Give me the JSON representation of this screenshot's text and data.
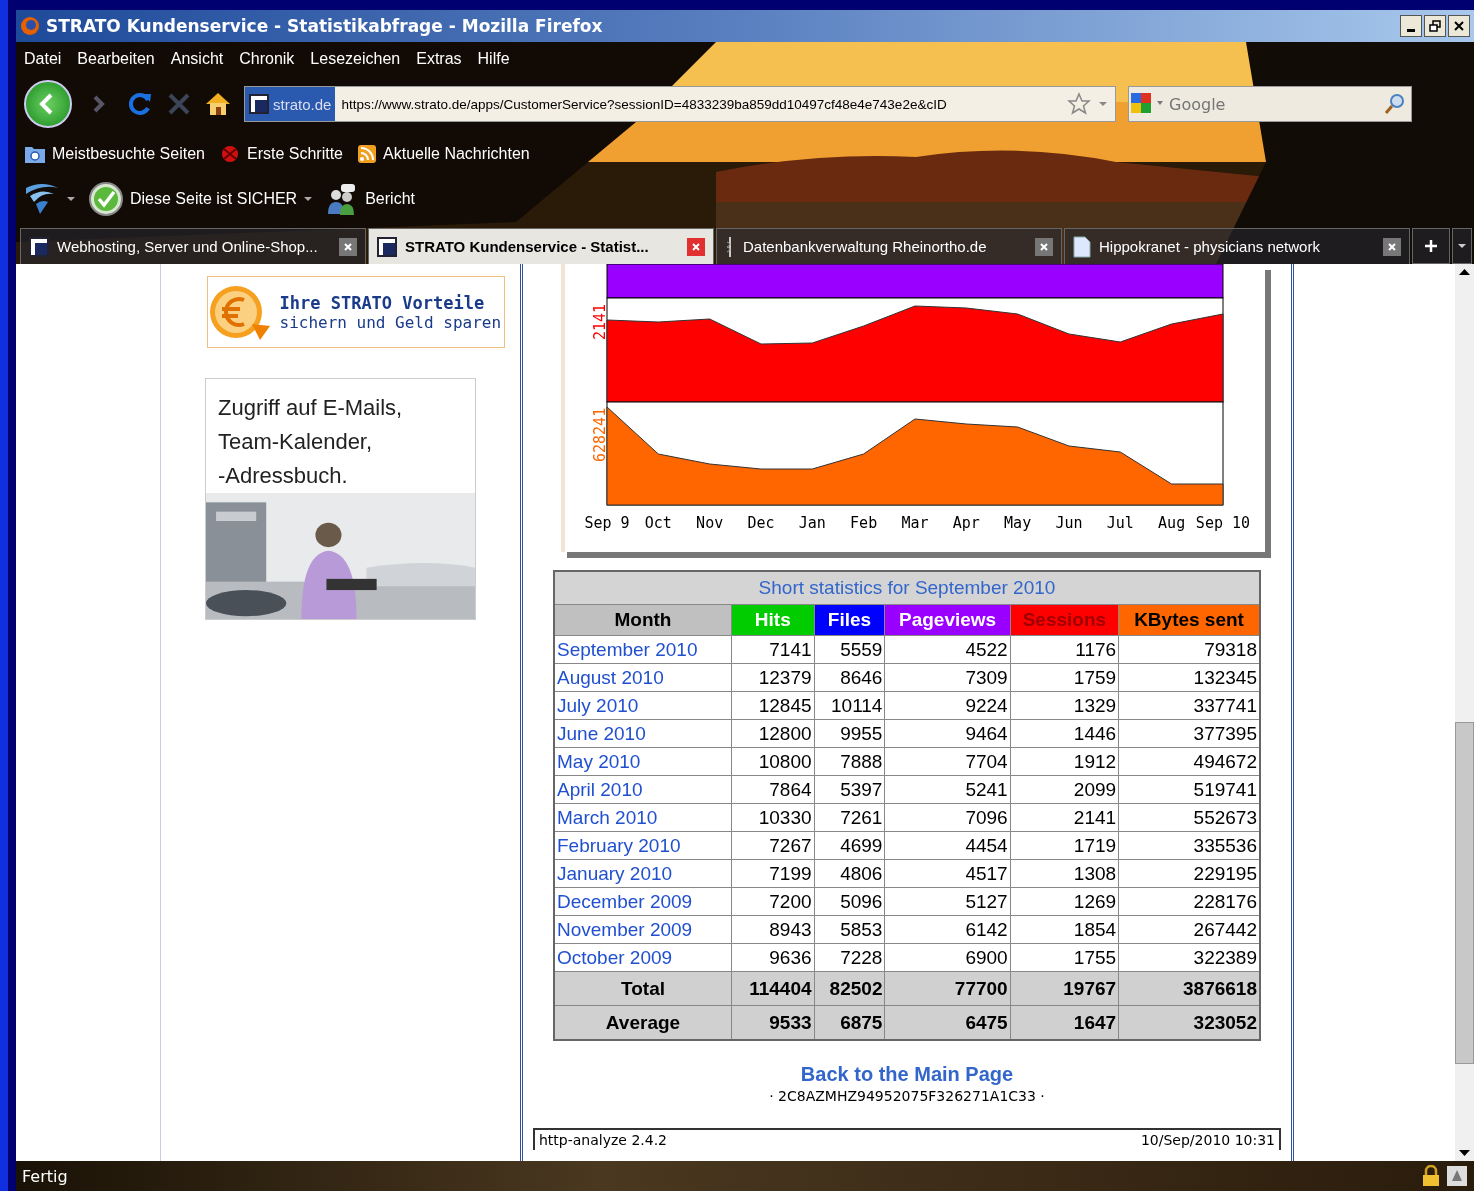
{
  "window": {
    "title": "STRATO Kundenservice - Statistikabfrage - Mozilla Firefox"
  },
  "menu": [
    "Datei",
    "Bearbeiten",
    "Ansicht",
    "Chronik",
    "Lesezeichen",
    "Extras",
    "Hilfe"
  ],
  "address_bar": {
    "site": "strato.de",
    "url": "https://www.strato.de/apps/CustomerService?sessionID=4833239ba859dd10497cf48e4e743e2e&cID"
  },
  "search": {
    "placeholder": "Google"
  },
  "bookmarks": [
    "Meistbesuchte Seiten",
    "Erste Schritte",
    "Aktuelle Nachrichten"
  ],
  "security_toolbar": {
    "status": "Diese Seite ist SICHER",
    "report": "Bericht"
  },
  "tabs": [
    {
      "label": "Webhosting, Server und Online-Shop...",
      "selected": false,
      "kind": "site"
    },
    {
      "label": "STRATO Kundenservice - Statist...",
      "selected": true,
      "kind": "site"
    },
    {
      "label": "Datenbankverwaltung Rheinortho.de",
      "selected": false,
      "kind": "db"
    },
    {
      "label": "Hippokranet - physicians network",
      "selected": false,
      "kind": "page"
    }
  ],
  "sidebar": {
    "promo": {
      "title": "Ihre STRATO Vorteile",
      "subtitle": "sichern und Geld sparen"
    },
    "ad": {
      "lines": [
        "Zugriff auf E-Mails,",
        "Team-Kalender,",
        "-Adressbuch."
      ]
    }
  },
  "chart": {
    "y_labels": [
      {
        "text": "2141",
        "color": "#ff0000"
      },
      {
        "text": "628241",
        "color": "#ff6600"
      }
    ],
    "x_labels": [
      "Sep 9",
      "Oct",
      "Nov",
      "Dec",
      "Jan",
      "Feb",
      "Mar",
      "Apr",
      "May",
      "Jun",
      "Jul",
      "Aug",
      "Sep 10"
    ]
  },
  "table": {
    "title": "Short statistics for September 2010",
    "columns": [
      {
        "label": "Month",
        "color": "#c0c0c0"
      },
      {
        "label": "Hits",
        "color": "#00cc00"
      },
      {
        "label": "Files",
        "color": "#0000ff"
      },
      {
        "label": "Pageviews",
        "color": "#9900ff"
      },
      {
        "label": "Sessions",
        "color": "#ff0000"
      },
      {
        "label": "KBytes sent",
        "color": "#ff6600"
      }
    ],
    "rows": [
      [
        "September 2010",
        "7141",
        "5559",
        "4522",
        "1176",
        "79318"
      ],
      [
        "August 2010",
        "12379",
        "8646",
        "7309",
        "1759",
        "132345"
      ],
      [
        "July 2010",
        "12845",
        "10114",
        "9224",
        "1329",
        "337741"
      ],
      [
        "June 2010",
        "12800",
        "9955",
        "9464",
        "1446",
        "377395"
      ],
      [
        "May 2010",
        "10800",
        "7888",
        "7704",
        "1912",
        "494672"
      ],
      [
        "April 2010",
        "7864",
        "5397",
        "5241",
        "2099",
        "519741"
      ],
      [
        "March 2010",
        "10330",
        "7261",
        "7096",
        "2141",
        "552673"
      ],
      [
        "February 2010",
        "7267",
        "4699",
        "4454",
        "1719",
        "335536"
      ],
      [
        "January 2010",
        "7199",
        "4806",
        "4517",
        "1308",
        "229195"
      ],
      [
        "December 2009",
        "7200",
        "5096",
        "5127",
        "1269",
        "228176"
      ],
      [
        "November 2009",
        "8943",
        "5853",
        "6142",
        "1854",
        "267442"
      ],
      [
        "October 2009",
        "9636",
        "7228",
        "6900",
        "1755",
        "322389"
      ]
    ],
    "summary": [
      [
        "Total",
        "114404",
        "82502",
        "77700",
        "19767",
        "3876618"
      ],
      [
        "Average",
        "9533",
        "6875",
        "6475",
        "1647",
        "323052"
      ]
    ]
  },
  "back_link": "Back to the Main Page",
  "code": "· 2C8AZMHZ94952075F326271A1C33 ·",
  "footer": {
    "left": "http-analyze 2.4.2",
    "right": "10/Sep/2010 10:31"
  },
  "status_bar": {
    "text": "Fertig"
  }
}
